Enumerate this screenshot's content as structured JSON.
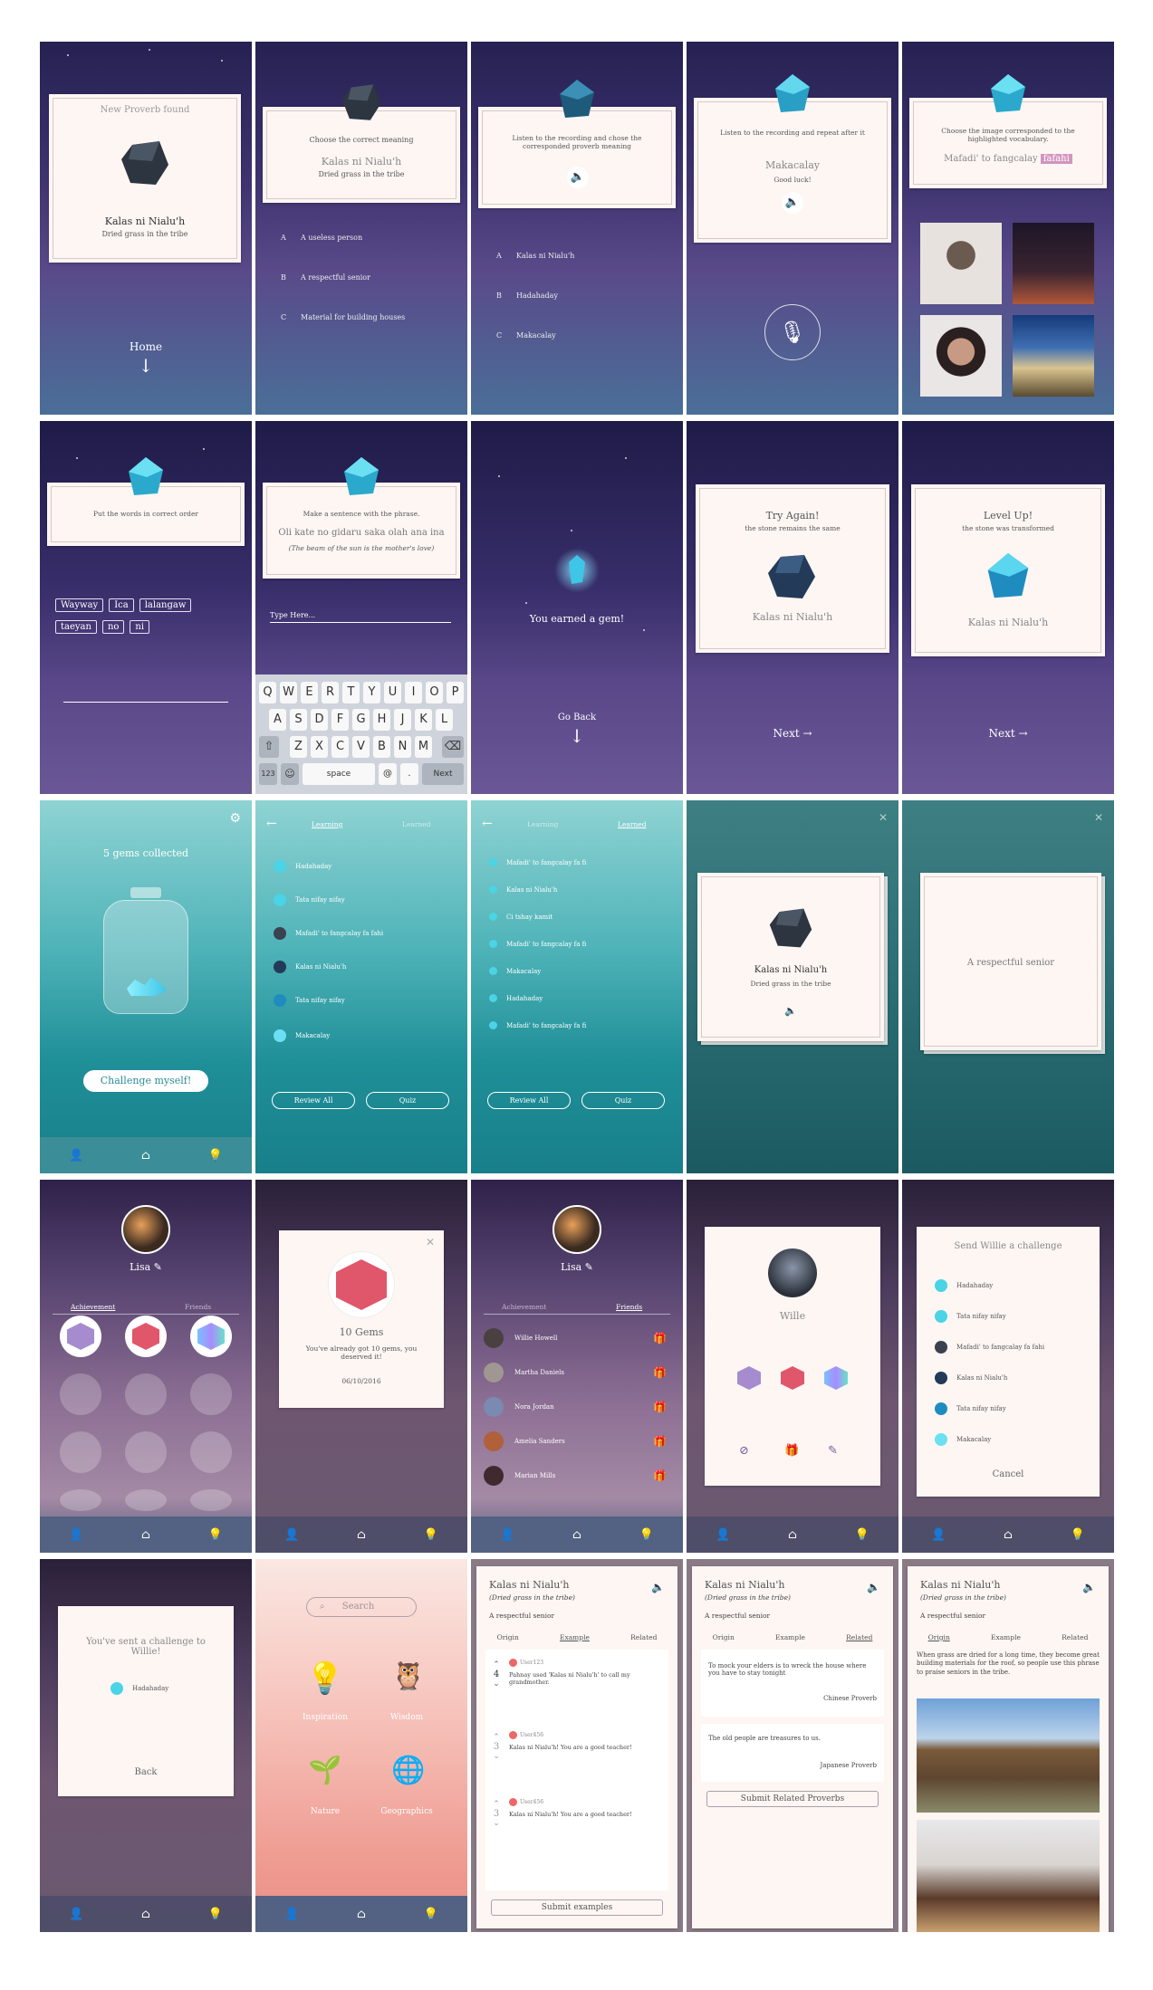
{
  "s1": {
    "title": "New Proverb found",
    "name": "Kalas ni Nialu'h",
    "meaning": "Dried grass in the tribe",
    "home": "Home",
    "arrow": "↓"
  },
  "s2": {
    "prompt": "Choose the correct meaning",
    "name": "Kalas ni Nialu'h",
    "meaning": "Dried grass in the tribe",
    "options": [
      {
        "k": "A",
        "v": "A useless person"
      },
      {
        "k": "B",
        "v": "A respectful senior"
      },
      {
        "k": "C",
        "v": "Material for building houses"
      }
    ]
  },
  "s3": {
    "prompt": "Listen to the recording and chose the corresponded proverb meaning",
    "options": [
      {
        "k": "A",
        "v": "Kalas ni Nialu'h"
      },
      {
        "k": "B",
        "v": "Hadahaday"
      },
      {
        "k": "C",
        "v": "Makacalay"
      }
    ]
  },
  "s4": {
    "prompt": "Listen to the recording and repeat after it",
    "word": "Makacalay",
    "sub": "Good luck!"
  },
  "s5": {
    "prompt": "Choose the image corresponded to the highlighted vocabulary.",
    "phrase": "Mafadi' to fangcalay",
    "highlight": "fafahi"
  },
  "s6": {
    "prompt": "Put the words in correct order",
    "words_row1": [
      "Wayway",
      "Ica",
      "lalangaw"
    ],
    "words_row2": [
      "taeyan",
      "no",
      "ni"
    ]
  },
  "s7": {
    "prompt": "Make a sentence with the phrase.",
    "phrase": "Oli kate no gidaru saka olah ana ina",
    "translation": "(The beam of the sun is the mother's love)",
    "input_placeholder": "Type Here...",
    "keys_row1": [
      "Q",
      "W",
      "E",
      "R",
      "T",
      "Y",
      "U",
      "I",
      "O",
      "P"
    ],
    "keys_row2": [
      "A",
      "S",
      "D",
      "F",
      "G",
      "H",
      "J",
      "K",
      "L"
    ],
    "keys_row3": [
      "Z",
      "X",
      "C",
      "V",
      "B",
      "N",
      "M"
    ],
    "k123": "123",
    "kspace": "space",
    "kat": "@",
    "kdot": ".",
    "knext": "Next"
  },
  "s8": {
    "text": "You earned a gem!",
    "back": "Go Back",
    "arrow": "↓"
  },
  "s9": {
    "title": "Try Again!",
    "sub": "the stone remains the same",
    "name": "Kalas ni Nialu'h",
    "next": "Next →"
  },
  "s10": {
    "title": "Level Up!",
    "sub": "the stone was transformed",
    "name": "Kalas ni Nialu'h",
    "next": "Next →"
  },
  "s11": {
    "count": "5 gems collected",
    "challenge": "Challenge myself!"
  },
  "s12": {
    "tab1": "Learning",
    "tab2": "Learned",
    "items": [
      "Hadahaday",
      "Tata nifay nifay",
      "Mafadi' to fangcalay fa fahi",
      "Kalas ni Nialu'h",
      "Tata nifay nifay",
      "Makacalay"
    ],
    "review": "Review All",
    "quiz": "Quiz"
  },
  "s13": {
    "tab1": "Learning",
    "tab2": "Learned",
    "items": [
      "Mafadi' to fangcalay fa fi",
      "Kalas ni Nialu'h",
      "Ci tshay kamit",
      "Mafadi' to fangcalay fa fi",
      "Makacalay",
      "Hadahaday",
      "Mafadi' to fangcalay fa fi"
    ],
    "review": "Review All",
    "quiz": "Quiz"
  },
  "s14": {
    "name": "Kalas ni Nialu'h",
    "meaning": "Dried grass in the tribe"
  },
  "s15": {
    "meaning": "A respectful senior"
  },
  "s16": {
    "user": "Lisa",
    "tab1": "Achievement",
    "tab2": "Friends"
  },
  "s17": {
    "count": "10 Gems",
    "msg": "You've already got 10 gems, you deserved it!",
    "date": "06/10/2016"
  },
  "s18": {
    "user": "Lisa",
    "tab1": "Achievement",
    "tab2": "Friends",
    "friends": [
      "Willie Howell",
      "Martha Daniels",
      "Nora Jordan",
      "Amelia Sanders",
      "Marian Mills"
    ]
  },
  "s19": {
    "name": "Wille"
  },
  "s20": {
    "title": "Send Willie a challenge",
    "items": [
      "Hadahaday",
      "Tata nifay nifay",
      "Mafadi' to fangcalay fa fahi",
      "Kalas ni Nialu'h",
      "Tata nifay nifay",
      "Makacalay"
    ],
    "cancel": "Cancel"
  },
  "s21": {
    "msg": "You've sent a challenge to Willie!",
    "item": "Hadahaday",
    "back": "Back"
  },
  "s22": {
    "search": "Search",
    "cats": [
      "Inspiration",
      "Wisdom",
      "Nature",
      "Geographics"
    ]
  },
  "s23": {
    "title": "Kalas ni Nialu'h",
    "sub": "(Dried grass in the tribe)",
    "meaning": "A respectful senior",
    "tabs": [
      "Origin",
      "Example",
      "Related"
    ],
    "posts": [
      {
        "user": "User123",
        "votes": "4",
        "text": "Pahnay used 'Kalas ni Nialu'h' to call my grandmother."
      },
      {
        "user": "User456",
        "votes": "3",
        "text": "Kalas ni Nialu'h! You are a good teacher!"
      },
      {
        "user": "User456",
        "votes": "3",
        "text": "Kalas ni Nialu'h! You are a good teacher!"
      }
    ],
    "submit": "Submit examples"
  },
  "s24": {
    "title": "Kalas ni Nialu'h",
    "sub": "(Dried grass in the tribe)",
    "meaning": "A respectful senior",
    "tabs": [
      "Origin",
      "Example",
      "Related"
    ],
    "p1": "To mock your elders is to wreck the house where you have to stay tonight",
    "p1src": "Chinese Proverb",
    "p2": "The old people are treasures to us.",
    "p2src": "Japanese Proverb",
    "submit": "Submit Related Proverbs"
  },
  "s25": {
    "title": "Kalas ni Nialu'h",
    "sub": "(Dried grass in the tribe)",
    "meaning": "A respectful senior",
    "tabs": [
      "Origin",
      "Example",
      "Related"
    ],
    "body": "When grass are dried for a long time, they become great building materials for the roof, so people use this phrase to praise seniors in the tribe."
  },
  "colors": {
    "accent": "#c5c0f0",
    "gem": "#4bd3e6",
    "stone": "#2d3540",
    "ruby": "#e0566a",
    "teal": "#1f8f98"
  }
}
